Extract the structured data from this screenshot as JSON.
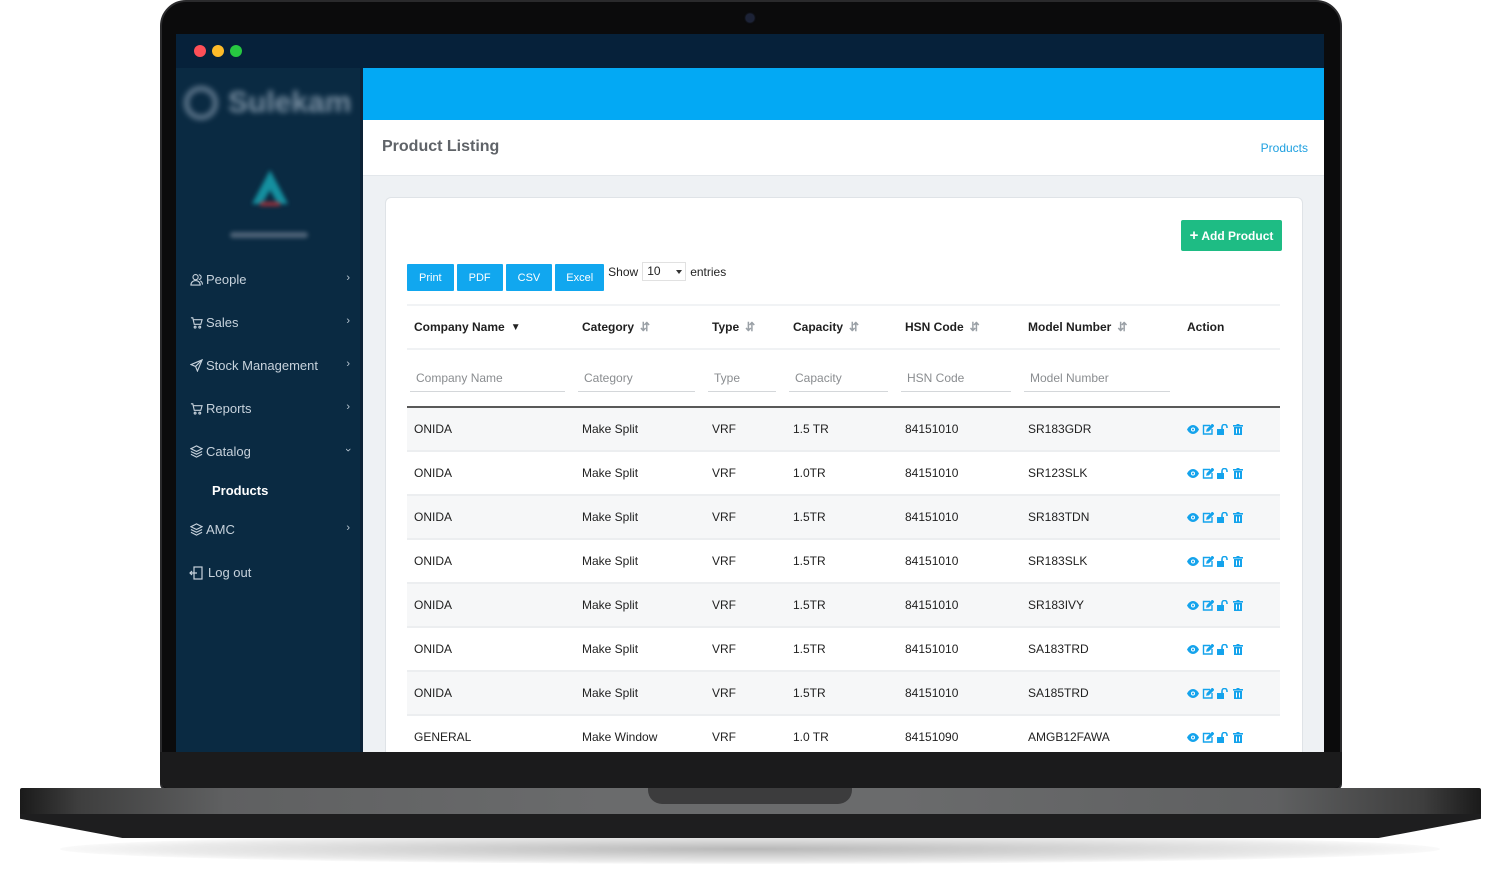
{
  "window": {
    "traffic_lights": {
      "close": "#fe4f57",
      "minimize": "#fdbb29",
      "maximize": "#27c841"
    }
  },
  "sidebar": {
    "brand_text": "Sulekam",
    "items": [
      {
        "label": "People",
        "icon": "users-icon",
        "expanded": false
      },
      {
        "label": "Sales",
        "icon": "cart-icon",
        "expanded": false
      },
      {
        "label": "Stock Management",
        "icon": "send-icon",
        "expanded": false
      },
      {
        "label": "Reports",
        "icon": "cart-icon",
        "expanded": false
      },
      {
        "label": "Catalog",
        "icon": "layers-icon",
        "expanded": true,
        "children": [
          {
            "label": "Products",
            "active": true
          }
        ]
      },
      {
        "label": "AMC",
        "icon": "layers-icon",
        "expanded": false
      },
      {
        "label": "Log out",
        "icon": "logout-icon"
      }
    ]
  },
  "header": {
    "page_title": "Product Listing",
    "breadcrumb": "Products",
    "accent_color": "#03a9f4"
  },
  "toolbar": {
    "add_button": "Add Product",
    "export_buttons": [
      "Print",
      "PDF",
      "CSV",
      "Excel"
    ],
    "show_label": "Show",
    "page_length": "10",
    "entries_label": "entries"
  },
  "table": {
    "columns": [
      {
        "label": "Company Name",
        "sort": "desc",
        "filter_placeholder": "Company Name"
      },
      {
        "label": "Category",
        "sort": "both",
        "filter_placeholder": "Category"
      },
      {
        "label": "Type",
        "sort": "both",
        "filter_placeholder": "Type"
      },
      {
        "label": "Capacity",
        "sort": "both",
        "filter_placeholder": "Capacity"
      },
      {
        "label": "HSN Code",
        "sort": "both",
        "filter_placeholder": "HSN Code"
      },
      {
        "label": "Model Number",
        "sort": "both",
        "filter_placeholder": "Model Number"
      },
      {
        "label": "Action",
        "sort": "none"
      }
    ],
    "rows": [
      {
        "company": "ONIDA",
        "category": "Make Split",
        "type": "VRF",
        "capacity": "1.5 TR",
        "hsn": "84151010",
        "model": "SR183GDR"
      },
      {
        "company": "ONIDA",
        "category": "Make Split",
        "type": "VRF",
        "capacity": "1.0TR",
        "hsn": "84151010",
        "model": "SR123SLK"
      },
      {
        "company": "ONIDA",
        "category": "Make Split",
        "type": "VRF",
        "capacity": "1.5TR",
        "hsn": "84151010",
        "model": "SR183TDN"
      },
      {
        "company": "ONIDA",
        "category": "Make Split",
        "type": "VRF",
        "capacity": "1.5TR",
        "hsn": "84151010",
        "model": "SR183SLK"
      },
      {
        "company": "ONIDA",
        "category": "Make Split",
        "type": "VRF",
        "capacity": "1.5TR",
        "hsn": "84151010",
        "model": "SR183IVY"
      },
      {
        "company": "ONIDA",
        "category": "Make Split",
        "type": "VRF",
        "capacity": "1.5TR",
        "hsn": "84151010",
        "model": "SA183TRD"
      },
      {
        "company": "ONIDA",
        "category": "Make Split",
        "type": "VRF",
        "capacity": "1.5TR",
        "hsn": "84151010",
        "model": "SA185TRD"
      },
      {
        "company": "GENERAL",
        "category": "Make Window",
        "type": "VRF",
        "capacity": "1.0 TR",
        "hsn": "84151090",
        "model": "AMGB12FAWA"
      }
    ],
    "row_actions": [
      "view-icon",
      "edit-icon",
      "unlock-icon",
      "delete-icon"
    ]
  }
}
